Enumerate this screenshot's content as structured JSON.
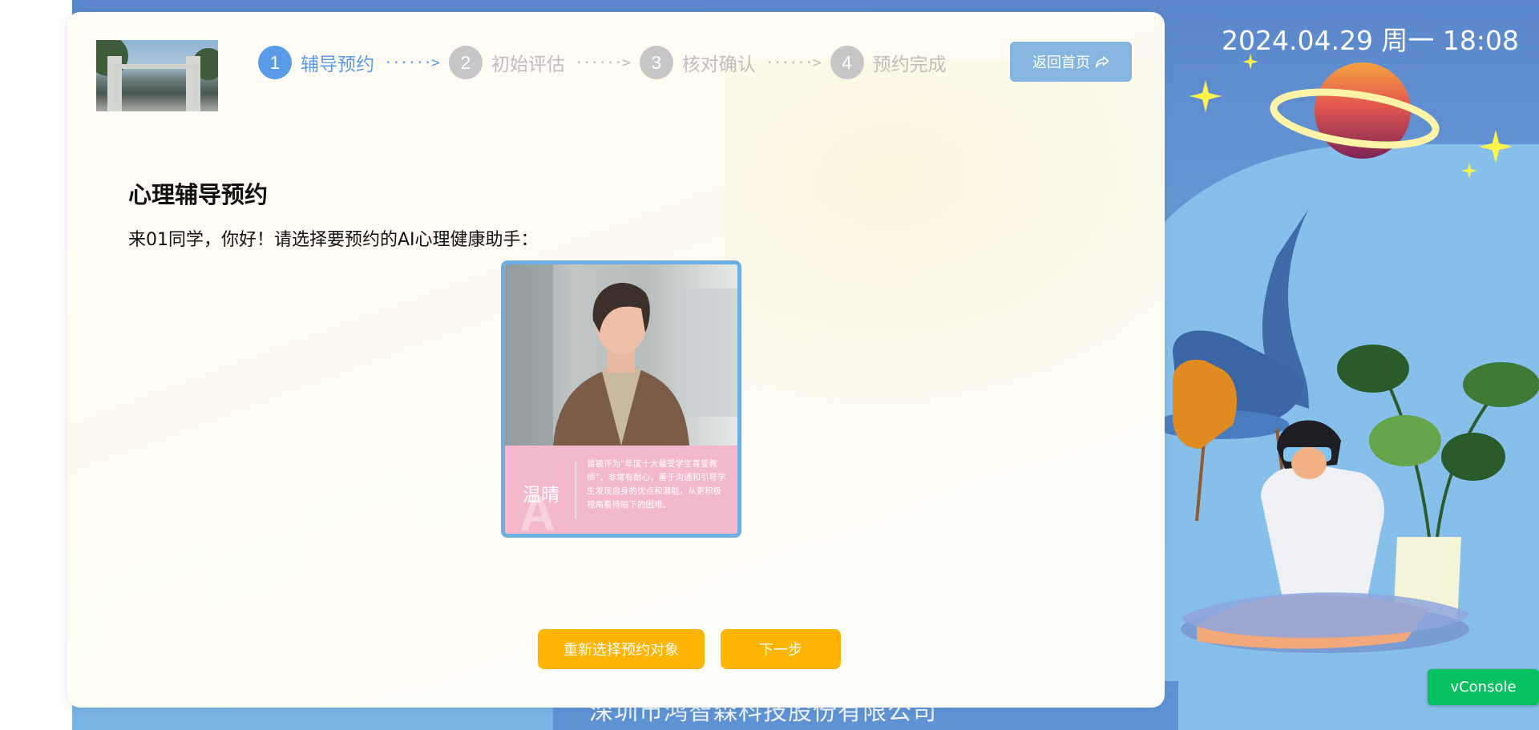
{
  "background": {
    "datetime": "2024.04.29 周一 18:08",
    "footer_company": "深圳市鸿智森科技股份有限公司"
  },
  "header": {
    "steps": [
      {
        "number": "1",
        "label": "辅导预约",
        "active": true
      },
      {
        "number": "2",
        "label": "初始评估",
        "active": false
      },
      {
        "number": "3",
        "label": "核对确认",
        "active": false
      },
      {
        "number": "4",
        "label": "预约完成",
        "active": false
      }
    ],
    "step_arrow": "······>",
    "home_button": {
      "label": "返回首页",
      "icon": "share-arrow-icon"
    }
  },
  "main": {
    "title": "心理辅导预约",
    "greeting": "来01同学，你好！请选择要预约的AI心理健康助手："
  },
  "counselor": {
    "letter": "A",
    "name": "温晴",
    "description": "曾被评为“年度十大最受学生喜爱教师”，非常有耐心，善于沟通和引导学生发现自身的优点和潜能，从更积极视角看待眼下的困难。"
  },
  "actions": {
    "reselect": "重新选择预约对象",
    "next": "下一步"
  },
  "vconsole": {
    "label": "vConsole"
  },
  "colors": {
    "accent_blue": "#5a9be8",
    "inactive_gray": "#c6c6c6",
    "action_yellow": "#ffb400",
    "home_button_blue": "#86b6e0",
    "card_pink": "#f4b8cc",
    "vconsole_green": "#07c160"
  }
}
